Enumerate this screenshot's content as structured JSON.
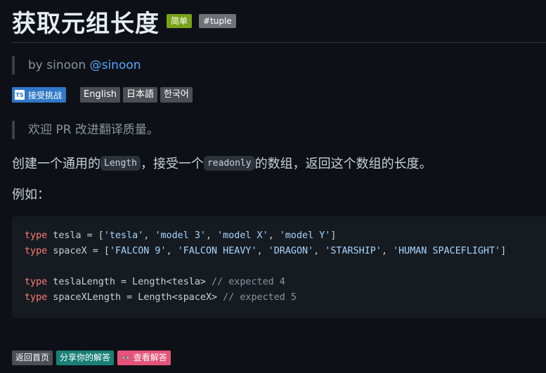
{
  "header": {
    "title": "获取元组长度",
    "difficulty": "简单",
    "tag": "#tuple"
  },
  "author": {
    "prefix": "by sinoon",
    "handle": "@sinoon"
  },
  "actions": {
    "ts_label": "TS",
    "accept_label": "接受挑战",
    "languages": [
      "English",
      "日本語",
      "한국어"
    ]
  },
  "notice": "欢迎 PR 改进翻译质量。",
  "description": {
    "part1": "创建一个通用的",
    "code1": "Length",
    "part2": "，接受一个",
    "code2": "readonly",
    "part3": "的数组，返回这个数组的长度。"
  },
  "example_label": "例如：",
  "code": {
    "line1": {
      "kw": "type",
      "rest_a": " tesla = [",
      "s1": "'tesla'",
      "s2": "'model 3'",
      "s3": "'model X'",
      "s4": "'model Y'",
      "end": "]"
    },
    "line2": {
      "kw": "type",
      "rest_a": " spaceX = [",
      "s1": "'FALCON 9'",
      "s2": "'FALCON HEAVY'",
      "s3": "'DRAGON'",
      "s4": "'STARSHIP'",
      "s5": "'HUMAN SPACEFLIGHT'",
      "end": "]"
    },
    "line3": {
      "kw": "type",
      "rest": " teslaLength = Length<tesla> ",
      "comment": "// expected 4"
    },
    "line4": {
      "kw": "type",
      "rest": " spaceXLength = Length<spaceX> ",
      "comment": "// expected 5"
    }
  },
  "footer": {
    "home": "返回首页",
    "share": "分享你的解答",
    "view": "查看解答"
  },
  "colors": {
    "easy_badge": "#7aa31a",
    "ts_button": "#3178c6",
    "share_button": "#1a8076",
    "view_button": "#e4547a",
    "link": "#58a6ff"
  }
}
